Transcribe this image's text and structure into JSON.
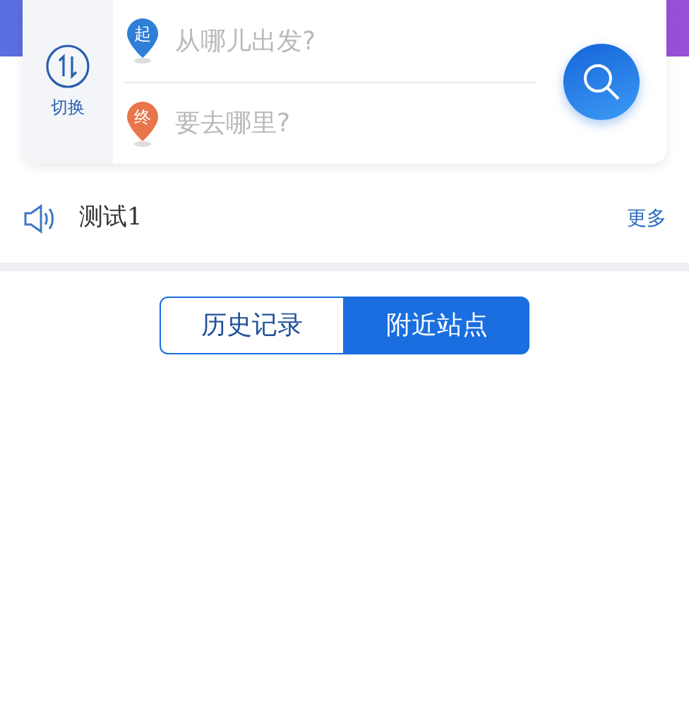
{
  "route": {
    "swap_label": "切换",
    "stops": [
      {
        "pin": "起",
        "placeholder": "从哪儿出发?",
        "color": "#2f7fd8"
      },
      {
        "pin": "终",
        "placeholder": "要去哪里?",
        "color": "#e8764a"
      }
    ]
  },
  "notice": {
    "text": "测试1",
    "more": "更多"
  },
  "tabs": [
    {
      "label": "历史记录",
      "selected": false
    },
    {
      "label": "附近站点",
      "selected": true
    }
  ]
}
